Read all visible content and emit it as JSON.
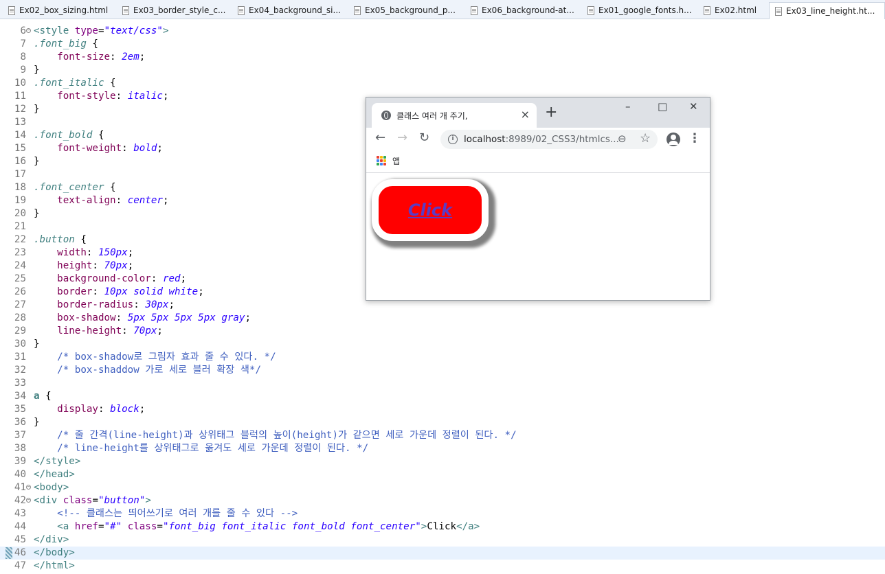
{
  "editor_tabs": [
    {
      "label": "Ex02_box_sizing.html",
      "active": false
    },
    {
      "label": "Ex03_border_style_c...",
      "active": false
    },
    {
      "label": "Ex04_background_si...",
      "active": false
    },
    {
      "label": "Ex05_background_p...",
      "active": false
    },
    {
      "label": "Ex06_background-at...",
      "active": false
    },
    {
      "label": "Ex01_google_fonts.h...",
      "active": false
    },
    {
      "label": "Ex02.html",
      "active": false
    },
    {
      "label": "Ex03_line_height.ht...",
      "active": true
    }
  ],
  "code_lines": [
    {
      "n": "6",
      "fold": true,
      "segs": [
        [
          "tg",
          "<style "
        ],
        [
          "at",
          "type"
        ],
        [
          "",
          "="
        ],
        [
          "av",
          "\"text/css\""
        ],
        [
          "tg",
          ">"
        ]
      ]
    },
    {
      "n": "7",
      "segs": [
        [
          "sel",
          ".font_big"
        ],
        [
          "",
          " {"
        ]
      ]
    },
    {
      "n": "8",
      "segs": [
        [
          "",
          "    "
        ],
        [
          "pr",
          "font-size"
        ],
        [
          "",
          ": "
        ],
        [
          "vl",
          "2em"
        ],
        [
          "",
          ";"
        ]
      ]
    },
    {
      "n": "9",
      "segs": [
        [
          "",
          "}"
        ]
      ]
    },
    {
      "n": "10",
      "segs": [
        [
          "sel",
          ".font_italic"
        ],
        [
          "",
          " {"
        ]
      ]
    },
    {
      "n": "11",
      "segs": [
        [
          "",
          "    "
        ],
        [
          "pr",
          "font-style"
        ],
        [
          "",
          ": "
        ],
        [
          "vl",
          "italic"
        ],
        [
          "",
          ";"
        ]
      ]
    },
    {
      "n": "12",
      "segs": [
        [
          "",
          "}"
        ]
      ]
    },
    {
      "n": "13",
      "segs": []
    },
    {
      "n": "14",
      "segs": [
        [
          "sel",
          ".font_bold"
        ],
        [
          "",
          " {"
        ]
      ]
    },
    {
      "n": "15",
      "segs": [
        [
          "",
          "    "
        ],
        [
          "pr",
          "font-weight"
        ],
        [
          "",
          ": "
        ],
        [
          "vl",
          "bold"
        ],
        [
          "",
          ";"
        ]
      ]
    },
    {
      "n": "16",
      "segs": [
        [
          "",
          "}"
        ]
      ]
    },
    {
      "n": "17",
      "segs": []
    },
    {
      "n": "18",
      "segs": [
        [
          "sel",
          ".font_center"
        ],
        [
          "",
          " {"
        ]
      ]
    },
    {
      "n": "19",
      "segs": [
        [
          "",
          "    "
        ],
        [
          "pr",
          "text-align"
        ],
        [
          "",
          ": "
        ],
        [
          "vl",
          "center"
        ],
        [
          "",
          ";"
        ]
      ]
    },
    {
      "n": "20",
      "segs": [
        [
          "",
          "}"
        ]
      ]
    },
    {
      "n": "21",
      "segs": []
    },
    {
      "n": "22",
      "segs": [
        [
          "sel",
          ".button"
        ],
        [
          "",
          " {"
        ]
      ]
    },
    {
      "n": "23",
      "segs": [
        [
          "",
          "    "
        ],
        [
          "pr",
          "width"
        ],
        [
          "",
          ": "
        ],
        [
          "vl",
          "150px"
        ],
        [
          "",
          ";"
        ]
      ]
    },
    {
      "n": "24",
      "segs": [
        [
          "",
          "    "
        ],
        [
          "pr",
          "height"
        ],
        [
          "",
          ": "
        ],
        [
          "vl",
          "70px"
        ],
        [
          "",
          ";"
        ]
      ]
    },
    {
      "n": "25",
      "segs": [
        [
          "",
          "    "
        ],
        [
          "pr",
          "background-color"
        ],
        [
          "",
          ": "
        ],
        [
          "vl",
          "red"
        ],
        [
          "",
          ";"
        ]
      ]
    },
    {
      "n": "26",
      "segs": [
        [
          "",
          "    "
        ],
        [
          "pr",
          "border"
        ],
        [
          "",
          ": "
        ],
        [
          "vl",
          "10px solid white"
        ],
        [
          "",
          ";"
        ]
      ]
    },
    {
      "n": "27",
      "segs": [
        [
          "",
          "    "
        ],
        [
          "pr",
          "border-radius"
        ],
        [
          "",
          ": "
        ],
        [
          "vl",
          "30px"
        ],
        [
          "",
          ";"
        ]
      ]
    },
    {
      "n": "28",
      "segs": [
        [
          "",
          "    "
        ],
        [
          "pr",
          "box-shadow"
        ],
        [
          "",
          ": "
        ],
        [
          "vl",
          "5px 5px 5px 5px gray"
        ],
        [
          "",
          ";"
        ]
      ]
    },
    {
      "n": "29",
      "segs": [
        [
          "",
          "    "
        ],
        [
          "pr",
          "line-height"
        ],
        [
          "",
          ": "
        ],
        [
          "vl",
          "70px"
        ],
        [
          "",
          ";"
        ]
      ]
    },
    {
      "n": "30",
      "segs": [
        [
          "",
          "}"
        ]
      ]
    },
    {
      "n": "31",
      "segs": [
        [
          "",
          "    "
        ],
        [
          "cm",
          "/* box-shadow로 그림자 효과 줄 수 있다. */"
        ]
      ]
    },
    {
      "n": "32",
      "segs": [
        [
          "",
          "    "
        ],
        [
          "cm",
          "/* box-shaddow 가로 세로 블러 확장 색*/"
        ]
      ]
    },
    {
      "n": "33",
      "segs": []
    },
    {
      "n": "34",
      "segs": [
        [
          "el",
          "a"
        ],
        [
          "",
          " {"
        ]
      ]
    },
    {
      "n": "35",
      "segs": [
        [
          "",
          "    "
        ],
        [
          "pr",
          "display"
        ],
        [
          "",
          ": "
        ],
        [
          "vl",
          "block"
        ],
        [
          "",
          ";"
        ]
      ]
    },
    {
      "n": "36",
      "segs": [
        [
          "",
          "}"
        ]
      ]
    },
    {
      "n": "37",
      "segs": [
        [
          "",
          "    "
        ],
        [
          "cm",
          "/* 줄 간격(line-height)과 상위태그 블럭의 높이(height)가 같으면 세로 가운데 정렬이 된다. */"
        ]
      ]
    },
    {
      "n": "38",
      "segs": [
        [
          "",
          "    "
        ],
        [
          "cm",
          "/* line-height를 상위태그로 옮겨도 세로 가운데 정렬이 된다. */"
        ]
      ]
    },
    {
      "n": "39",
      "segs": [
        [
          "tg",
          "</style>"
        ]
      ]
    },
    {
      "n": "40",
      "segs": [
        [
          "tg",
          "</head>"
        ]
      ]
    },
    {
      "n": "41",
      "fold": true,
      "segs": [
        [
          "tg",
          "<body>"
        ]
      ]
    },
    {
      "n": "42",
      "fold": true,
      "segs": [
        [
          "tg",
          "<div "
        ],
        [
          "at",
          "class"
        ],
        [
          "",
          "="
        ],
        [
          "av",
          "\"button\""
        ],
        [
          "tg",
          ">"
        ]
      ]
    },
    {
      "n": "43",
      "segs": [
        [
          "",
          "    "
        ],
        [
          "cm",
          "<!-- 클래스는 띄어쓰기로 여러 개를 줄 수 있다 -->"
        ]
      ]
    },
    {
      "n": "44",
      "segs": [
        [
          "",
          "    "
        ],
        [
          "tg",
          "<a "
        ],
        [
          "at",
          "href"
        ],
        [
          "",
          "="
        ],
        [
          "av",
          "\"#\""
        ],
        [
          "",
          " "
        ],
        [
          "at",
          "class"
        ],
        [
          "",
          "="
        ],
        [
          "av",
          "\"font_big font_italic font_bold font_center\""
        ],
        [
          "tg",
          ">"
        ],
        [
          "",
          "Click"
        ],
        [
          "tg",
          "</a>"
        ]
      ]
    },
    {
      "n": "45",
      "segs": [
        [
          "tg",
          "</div>"
        ]
      ]
    },
    {
      "n": "46",
      "current": true,
      "marker": true,
      "segs": [
        [
          "tg",
          "</body>"
        ]
      ]
    },
    {
      "n": "47",
      "segs": [
        [
          "tg",
          "</html>"
        ]
      ]
    }
  ],
  "browser": {
    "tab_title": "클래스 여러 개 주기,",
    "url_host": "localhost",
    "url_rest": ":8989/02_CSS3/htmlcs...",
    "bookmark_label": "앱",
    "link_text": "Click"
  },
  "icons": {
    "tab_close": "×",
    "new_tab": "+",
    "minimize": "–",
    "maximize": "□",
    "close": "✕",
    "back": "←",
    "forward": "→",
    "reload": "↻",
    "info": "i",
    "zoom": "⊖",
    "star": "☆",
    "menu": "⋮"
  },
  "colors": {
    "button_bg": "#ff0000",
    "link": "#5b3cc4",
    "current_line": "#e8f2fe"
  }
}
